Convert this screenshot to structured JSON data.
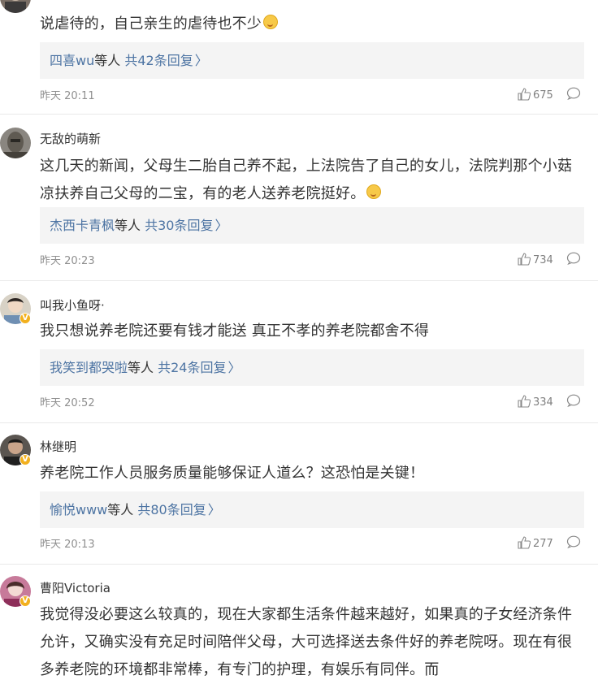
{
  "comments": [
    {
      "username": "",
      "text": "说虐待的，自己亲生的虐待也不少",
      "emoji": "smile-emoji",
      "replies": {
        "users": "四喜wu",
        "middle": "等人 ",
        "count": "共42条回复"
      },
      "time": "昨天 20:11",
      "likes": "675"
    },
    {
      "username": "无敌的萌新",
      "text": "这几天的新闻，父母生二胎自己养不起，上法院告了自己的女儿，法院判那个小菇凉扶养自己父母的二宝，有的老人送养老院挺好。",
      "emoji": "tongue-emoji",
      "replies": {
        "users": "杰西卡青枫",
        "middle": "等人 ",
        "count": "共30条回复"
      },
      "time": "昨天 20:23",
      "likes": "734"
    },
    {
      "username": "叫我小鱼呀·",
      "verified": "V",
      "text": "我只想说养老院还要有钱才能送 真正不孝的养老院都舍不得",
      "replies": {
        "users": "我笑到都哭啦",
        "middle": "等人 ",
        "count": "共24条回复"
      },
      "time": "昨天 20:52",
      "likes": "334"
    },
    {
      "username": "林继明",
      "verified": "V",
      "text": "养老院工作人员服务质量能够保证人道么？这恐怕是关键！",
      "replies": {
        "users": "愉悦www",
        "middle": "等人 ",
        "count": "共80条回复"
      },
      "time": "昨天 20:13",
      "likes": "277"
    },
    {
      "username": "曹阳Victoria",
      "verified": "V",
      "text": "我觉得没必要这么较真的，现在大家都生活条件越来越好，如果真的子女经济条件允许，又确实没有充足时间陪伴父母，大可选择送去条件好的养老院呀。现在有很多养老院的环境都非常棒，有专门的护理，有娱乐有同伴。而"
    }
  ],
  "chevron": "〉",
  "colors": {
    "link": "#4d74a3",
    "reply_bg": "#f4f4f4",
    "meta": "#8f8f8f",
    "badge": "#f2b01e"
  }
}
